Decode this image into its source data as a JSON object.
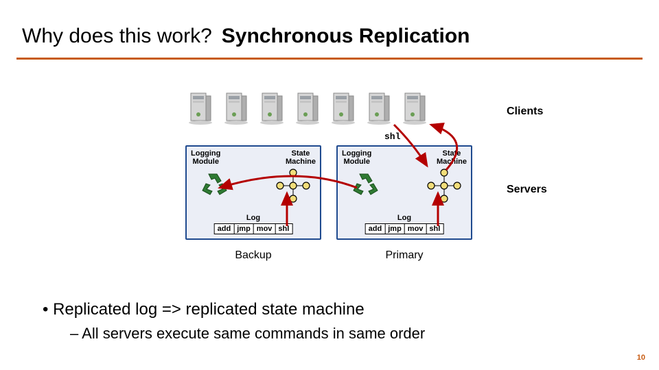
{
  "title": {
    "left": "Why does this work?",
    "right": "Synchronous Replication"
  },
  "labels": {
    "clients": "Clients",
    "servers": "Servers",
    "shl": "shl",
    "logging_module": "Logging\nModule",
    "state_machine": "State\nMachine",
    "log": "Log",
    "backup": "Backup",
    "primary": "Primary"
  },
  "log_entries": [
    "add",
    "jmp",
    "mov",
    "shl"
  ],
  "client_count": 7,
  "bullets": {
    "main": "Replicated log => replicated state machine",
    "sub": "All servers execute same commands in same order"
  },
  "page": "10",
  "colors": {
    "accent": "#c75b12",
    "server_border": "#1f4a8f",
    "arrow": "#b40000"
  }
}
